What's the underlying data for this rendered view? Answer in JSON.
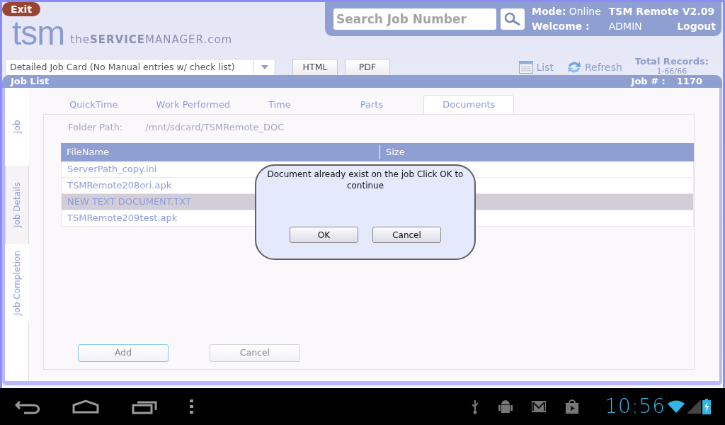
{
  "exit_button": "Exit",
  "logo": {
    "mark": "tsm",
    "tagline": "the**SERVICE**MANAGER.com"
  },
  "header": {
    "search": {
      "placeholder": "Search Job Number"
    },
    "mode_label": "Mode:",
    "mode_value": "Online",
    "app_version": "TSM Remote V2.09",
    "welcome_label": "Welcome :",
    "user": "ADMIN",
    "logout": "Logout"
  },
  "toolbar": {
    "report_select": "Detailed Job Card (No Manual entries w/ check list)",
    "buttons": [
      "HTML",
      "PDF"
    ],
    "list": "List",
    "refresh": "Refresh",
    "total_label": "Total Records:",
    "total_value": "1-66/66"
  },
  "panel": {
    "title": "Job List",
    "job_label": "Job # :",
    "job_number": "1170"
  },
  "side_tabs": [
    {
      "label": "Job",
      "selected": false
    },
    {
      "label": "Job Details",
      "selected": true
    },
    {
      "label": "Job Completion",
      "selected": false
    }
  ],
  "tabs": [
    {
      "label": "QuickTime",
      "selected": false
    },
    {
      "label": "Work Performed",
      "selected": false
    },
    {
      "label": "Time",
      "selected": false
    },
    {
      "label": "Parts",
      "selected": false
    },
    {
      "label": "Documents",
      "selected": true
    }
  ],
  "folder": {
    "label": "Folder Path:",
    "value": "/mnt/sdcard/TSMRemote_DOC"
  },
  "table": {
    "columns": [
      "FileName",
      "Size"
    ],
    "rows": [
      {
        "name": "ServerPath_copy.ini",
        "selected": false
      },
      {
        "name": "TSMRemote208ori.apk",
        "selected": false
      },
      {
        "name": "NEW TEXT DOCUMENT.TXT",
        "selected": true
      },
      {
        "name": "TSMRemote209test.apk",
        "selected": false
      }
    ]
  },
  "actions": [
    {
      "label": "Add",
      "focused": true
    },
    {
      "label": "Cancel",
      "focused": false
    }
  ],
  "dialog": {
    "message": "Document already exist on the job Click OK to continue",
    "buttons": [
      "OK",
      "Cancel"
    ]
  },
  "status_bar": {
    "time": "10:56"
  }
}
